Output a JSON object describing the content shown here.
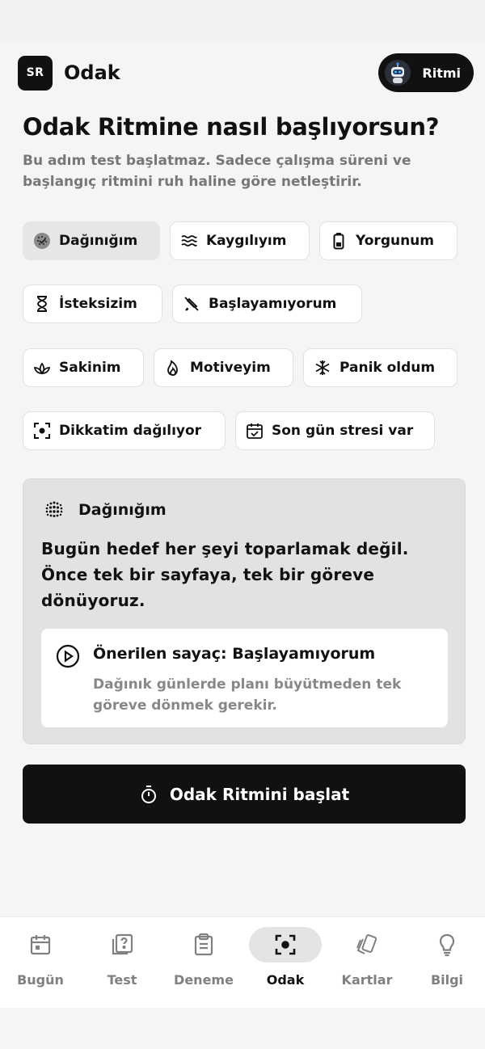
{
  "header": {
    "logo_text": "SR",
    "title": "Odak",
    "ritmi_label": "Ritmi"
  },
  "page": {
    "title": "Odak Ritmine nasıl başlıyorsun?",
    "subtitle": "Bu adım test başlatmaz. Sadece çalışma süreni ve başlangıç ritmini ruh haline göre netleştirir."
  },
  "moods": [
    {
      "label": "Dağınığım",
      "icon": "scatter-circle-icon",
      "selected": true
    },
    {
      "label": "Kaygılıyım",
      "icon": "waves-icon",
      "selected": false
    },
    {
      "label": "Yorgunum",
      "icon": "battery-low-icon",
      "selected": false
    },
    {
      "label": "İsteksizim",
      "icon": "hourglass-icon",
      "selected": false
    },
    {
      "label": "Başlayamıyorum",
      "icon": "pen-off-icon",
      "selected": false
    },
    {
      "label": "Sakinim",
      "icon": "lotus-icon",
      "selected": false
    },
    {
      "label": "Motiveyim",
      "icon": "flame-icon",
      "selected": false
    },
    {
      "label": "Panik oldum",
      "icon": "snowflake-icon",
      "selected": false
    },
    {
      "label": "Dikkatim dağılıyor",
      "icon": "focus-frame-icon",
      "selected": false
    },
    {
      "label": "Son gün stresi var",
      "icon": "calendar-check-icon",
      "selected": false
    }
  ],
  "card": {
    "title": "Dağınığım",
    "body": "Bugün hedef her şeyi toparlamak değil. Önce tek bir sayfaya, tek bir göreve dönüyoruz.",
    "suggestion_title": "Önerilen sayaç: Başlayamıyorum",
    "suggestion_desc": "Dağınık günlerde planı büyütmeden tek göreve dönmek gerekir."
  },
  "start_button": {
    "label": "Odak Ritmini başlat"
  },
  "nav": [
    {
      "label": "Bugün",
      "icon": "calendar-icon",
      "active": false
    },
    {
      "label": "Test",
      "icon": "question-book-icon",
      "active": false
    },
    {
      "label": "Deneme",
      "icon": "clipboard-icon",
      "active": false
    },
    {
      "label": "Odak",
      "icon": "focus-icon",
      "active": true
    },
    {
      "label": "Kartlar",
      "icon": "cards-icon",
      "active": false
    },
    {
      "label": "Bilgi",
      "icon": "lightbulb-icon",
      "active": false
    }
  ],
  "colors": {
    "accent": "#111111",
    "muted": "#808080",
    "background": "#f5f5f7"
  }
}
